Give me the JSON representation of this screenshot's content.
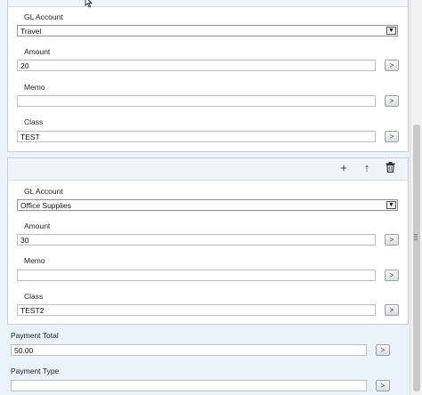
{
  "lines": [
    {
      "gl_account_label": "GL Account",
      "gl_account_value": "Travel",
      "amount_label": "Amount",
      "amount_value": "20",
      "memo_label": "Memo",
      "memo_value": "",
      "class_label": "Class",
      "class_value": "TEST"
    },
    {
      "gl_account_label": "GL Account",
      "gl_account_value": "Office Supplies",
      "amount_label": "Amount",
      "amount_value": "30",
      "memo_label": "Memo",
      "memo_value": "",
      "class_label": "Class",
      "class_value": "TEST2"
    }
  ],
  "line_actions": {
    "add": "+",
    "move_up": "↑",
    "delete": "🗑"
  },
  "lookup_button_label": ">",
  "dropdown_glyph": "▼",
  "payment": {
    "total_label": "Payment Total",
    "total_value": "50.00",
    "type_label": "Payment Type",
    "type_value": ""
  }
}
